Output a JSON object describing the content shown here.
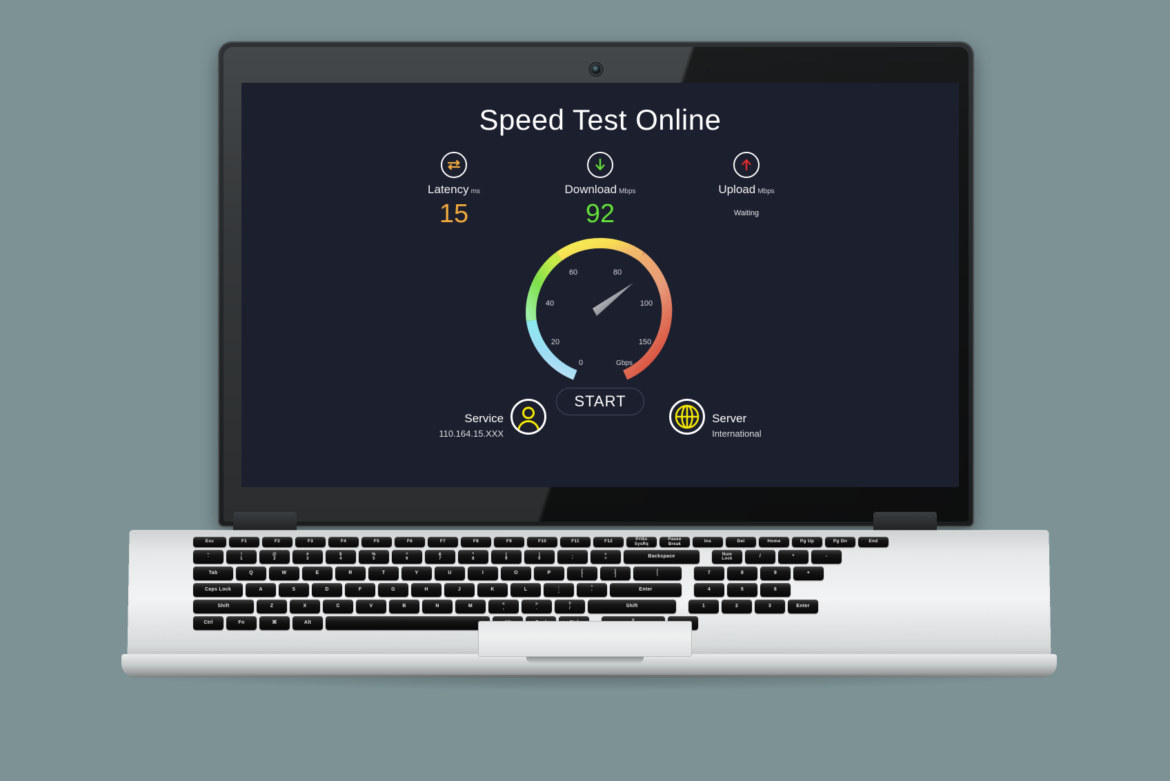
{
  "app": {
    "title": "Speed Test Online",
    "background_color": "#1c1f2e"
  },
  "metrics": [
    {
      "id": "latency",
      "icon": "latency-exchange-icon",
      "label": "Latency",
      "unit": "ms",
      "value": "15",
      "color": "#f0a83c"
    },
    {
      "id": "download",
      "icon": "download-arrow-icon",
      "label": "Download",
      "unit": "Mbps",
      "value": "92",
      "color": "#63e138"
    },
    {
      "id": "upload",
      "icon": "upload-arrow-icon",
      "label": "Upload",
      "unit": "Mbps",
      "value": "",
      "status": "Waiting",
      "color": "#e02b2b"
    }
  ],
  "chart_data": {
    "type": "gauge",
    "title": "Speed gauge",
    "unit_label": "Gbps",
    "tick_labels": [
      "0",
      "20",
      "40",
      "60",
      "80",
      "100",
      "150"
    ],
    "tick_values": [
      0,
      20,
      40,
      60,
      80,
      100,
      150
    ],
    "min": 0,
    "max": 150,
    "needle_value": 100,
    "arc_colors": [
      "#bfe0f2",
      "#8fd4f2",
      "#7fe3e8",
      "#a8ef7a",
      "#7ee04a",
      "#f2ef5a",
      "#f7d94a",
      "#f0b46a",
      "#e8a06a",
      "#e07a6a",
      "#d94a3a"
    ],
    "needle_color": "#f2f2f2"
  },
  "start_button": {
    "label": "START"
  },
  "footer": {
    "service": {
      "icon": "person-icon",
      "title": "Service",
      "value": "110.164.15.XXX",
      "icon_color": "#f5e800"
    },
    "server": {
      "icon": "globe-icon",
      "title": "Server",
      "value": "International",
      "icon_color": "#f5e800"
    }
  },
  "keyboard": {
    "fn_row": [
      "Esc",
      "F1",
      "F2",
      "F3",
      "F4",
      "F5",
      "F6",
      "F7",
      "F8",
      "F9",
      "F10",
      "F11",
      "F12",
      "PrtSc\nSysRq",
      "Pause\nBreak",
      "Ins",
      "Del",
      "Home",
      "Pg Up",
      "Pg Dn",
      "End"
    ],
    "num_row": [
      "~\n`",
      "!\n1",
      "@\n2",
      "#\n3",
      "$\n4",
      "%\n5",
      "^\n6",
      "&\n7",
      "*\n8",
      "(\n9",
      ")\n0",
      "_\n-",
      "+\n=",
      "Backspace"
    ],
    "num_row_pad": [
      "Num\nLock",
      "/",
      "*",
      "-"
    ],
    "q_row": [
      "Tab",
      "Q",
      "W",
      "E",
      "R",
      "T",
      "Y",
      "U",
      "I",
      "O",
      "P",
      "{\n[",
      "}\n]",
      "|\n\\"
    ],
    "q_row_pad": [
      "7",
      "8",
      "9",
      "+"
    ],
    "a_row": [
      "Caps Lock",
      "A",
      "S",
      "D",
      "F",
      "G",
      "H",
      "J",
      "K",
      "L",
      ":\n;",
      "\"\n'",
      "Enter"
    ],
    "a_row_pad": [
      "4",
      "5",
      "6"
    ],
    "z_row": [
      "Shift",
      "Z",
      "X",
      "C",
      "V",
      "B",
      "N",
      "M",
      "<\n,",
      ">\n.",
      "?\n/",
      "Shift"
    ],
    "z_row_pad": [
      "1",
      "2",
      "3",
      "Enter"
    ],
    "space_row": [
      "Ctrl",
      "Fn",
      "⌘",
      "Alt",
      " ",
      "Alt",
      "Cmd",
      "Ctrl"
    ],
    "space_row_pad": [
      "0\nIns",
      ".\nDel"
    ]
  }
}
